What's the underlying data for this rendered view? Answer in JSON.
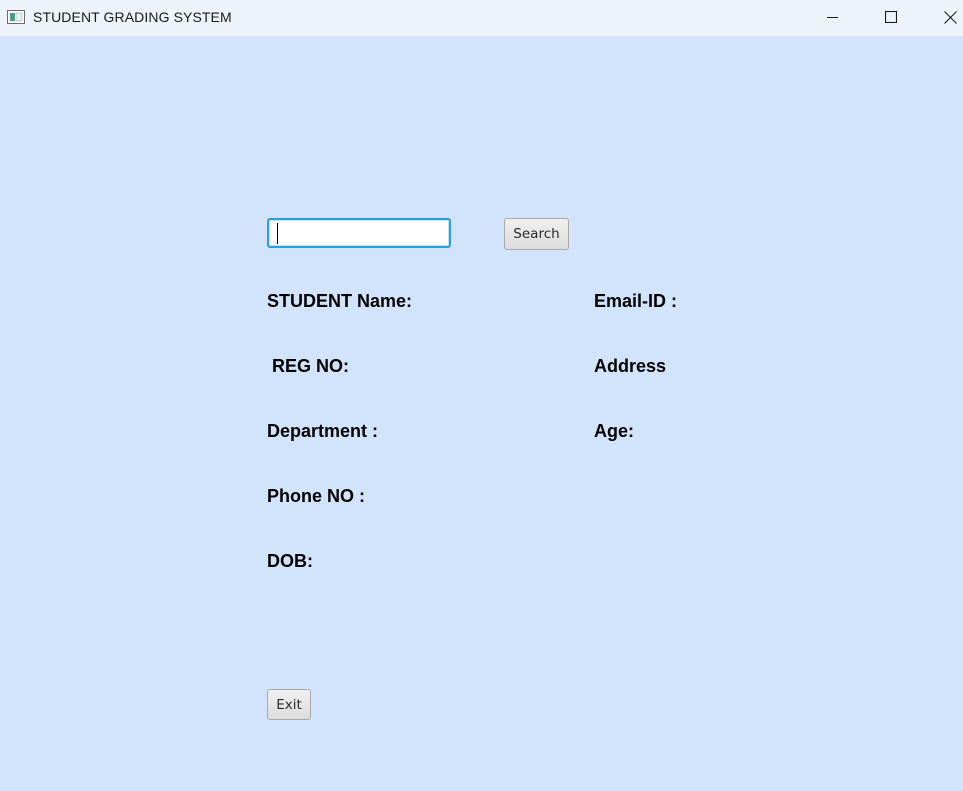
{
  "window": {
    "title": "STUDENT GRADING SYSTEM",
    "controls": {
      "minimize_icon": "minimize-icon",
      "maximize_icon": "maximize-icon",
      "close_icon": "close-icon"
    }
  },
  "search": {
    "value": "",
    "button_label": "Search"
  },
  "fields": {
    "student_name": "STUDENT Name:",
    "reg_no": " REG NO:",
    "department": "Department :",
    "phone_no": "Phone NO :",
    "dob": "DOB:",
    "email_id": "Email-ID :",
    "address": "Address",
    "age": "Age:"
  },
  "footer": {
    "exit_label": "Exit"
  },
  "colors": {
    "background": "#d2e4fb",
    "titlebar": "#eef2f9",
    "focus_border": "#2aa0d6"
  }
}
